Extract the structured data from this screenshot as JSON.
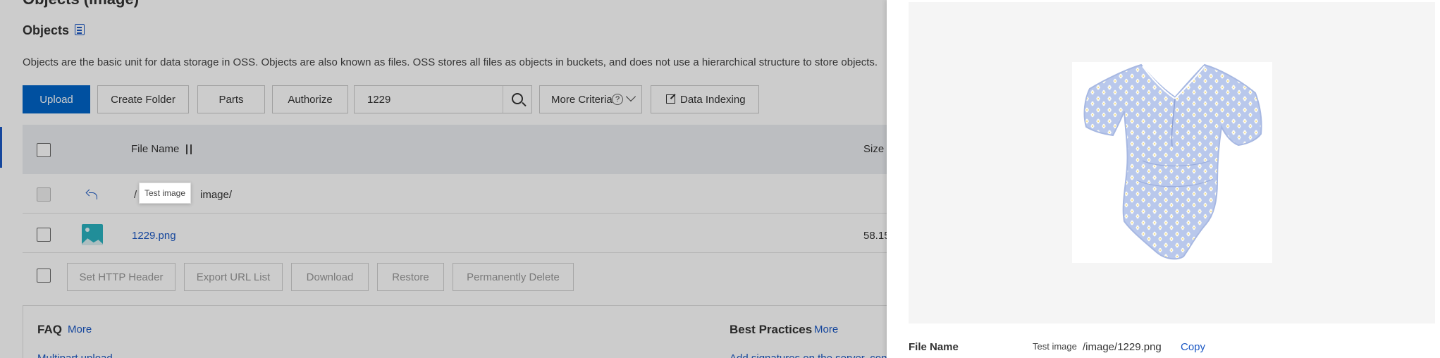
{
  "page": {
    "cut_title": "Objects (image)",
    "title": "Objects",
    "description": "Objects are the basic unit for data storage in OSS. Objects are also known as files. OSS stores all files as objects in buckets, and does not use a hierarchical structure to store objects."
  },
  "toolbar": {
    "upload": "Upload",
    "create_folder": "Create Folder",
    "parts": "Parts",
    "authorize": "Authorize",
    "search_value": "1229",
    "more_criteria": "More Criteria",
    "help": "?",
    "data_indexing": "Data Indexing"
  },
  "table": {
    "col_file_name": "File Name",
    "col_size": "Size",
    "parent_slash": "/",
    "tooltip": "Test image",
    "parent_path": "image/",
    "rows": [
      {
        "name": "1229.png",
        "size": "58.15"
      }
    ]
  },
  "batch_actions": {
    "set_http_header": "Set HTTP Header",
    "export_url_list": "Export URL List",
    "download": "Download",
    "restore": "Restore",
    "permanently_delete": "Permanently Delete"
  },
  "faq": {
    "title": "FAQ",
    "more": "More",
    "link": "Multipart upload"
  },
  "best_practices": {
    "title": "Best Practices",
    "more": "More",
    "link": "Add signatures on the server, con"
  },
  "drawer": {
    "file_name_label": "File Name",
    "file_tip": "Test image",
    "file_path": "/image/1229.png",
    "copy": "Copy"
  },
  "colors": {
    "primary": "#0064c8",
    "link": "#1b58c4",
    "swimsuit_base": "#b9c8ec",
    "daisy": "#fbfbf3",
    "daisy_center": "#f2cf58"
  }
}
